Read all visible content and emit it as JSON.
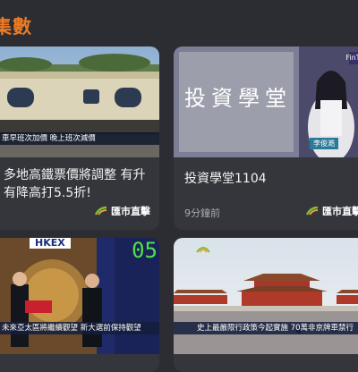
{
  "section": {
    "title": "集數"
  },
  "cards": [
    {
      "title": "多地高鐵票價將調整 有升有降高打5.5折!",
      "caption": "車早班次加價 晚上班次減價",
      "meta": "",
      "brand": "匯市直擊"
    },
    {
      "title": "投資學堂1104",
      "overlay": "投資學堂",
      "channel_logo": "FinTV",
      "presenter_name": "李俊澔",
      "meta": "9分鐘前",
      "brand": "匯市直擊"
    },
    {
      "sign": "HKEX",
      "clock": "05",
      "caption": "未來亞太區將繼續觀望 新大選前保持觀望",
      "title": "",
      "meta": "",
      "brand": ""
    },
    {
      "caption": "史上最嚴限行政策今起實施 70萬非京牌車禁行",
      "title": "",
      "meta": "",
      "brand": ""
    }
  ],
  "colors": {
    "accent": "#f07a22",
    "card": "#34363c",
    "bg": "#2b2d32"
  }
}
